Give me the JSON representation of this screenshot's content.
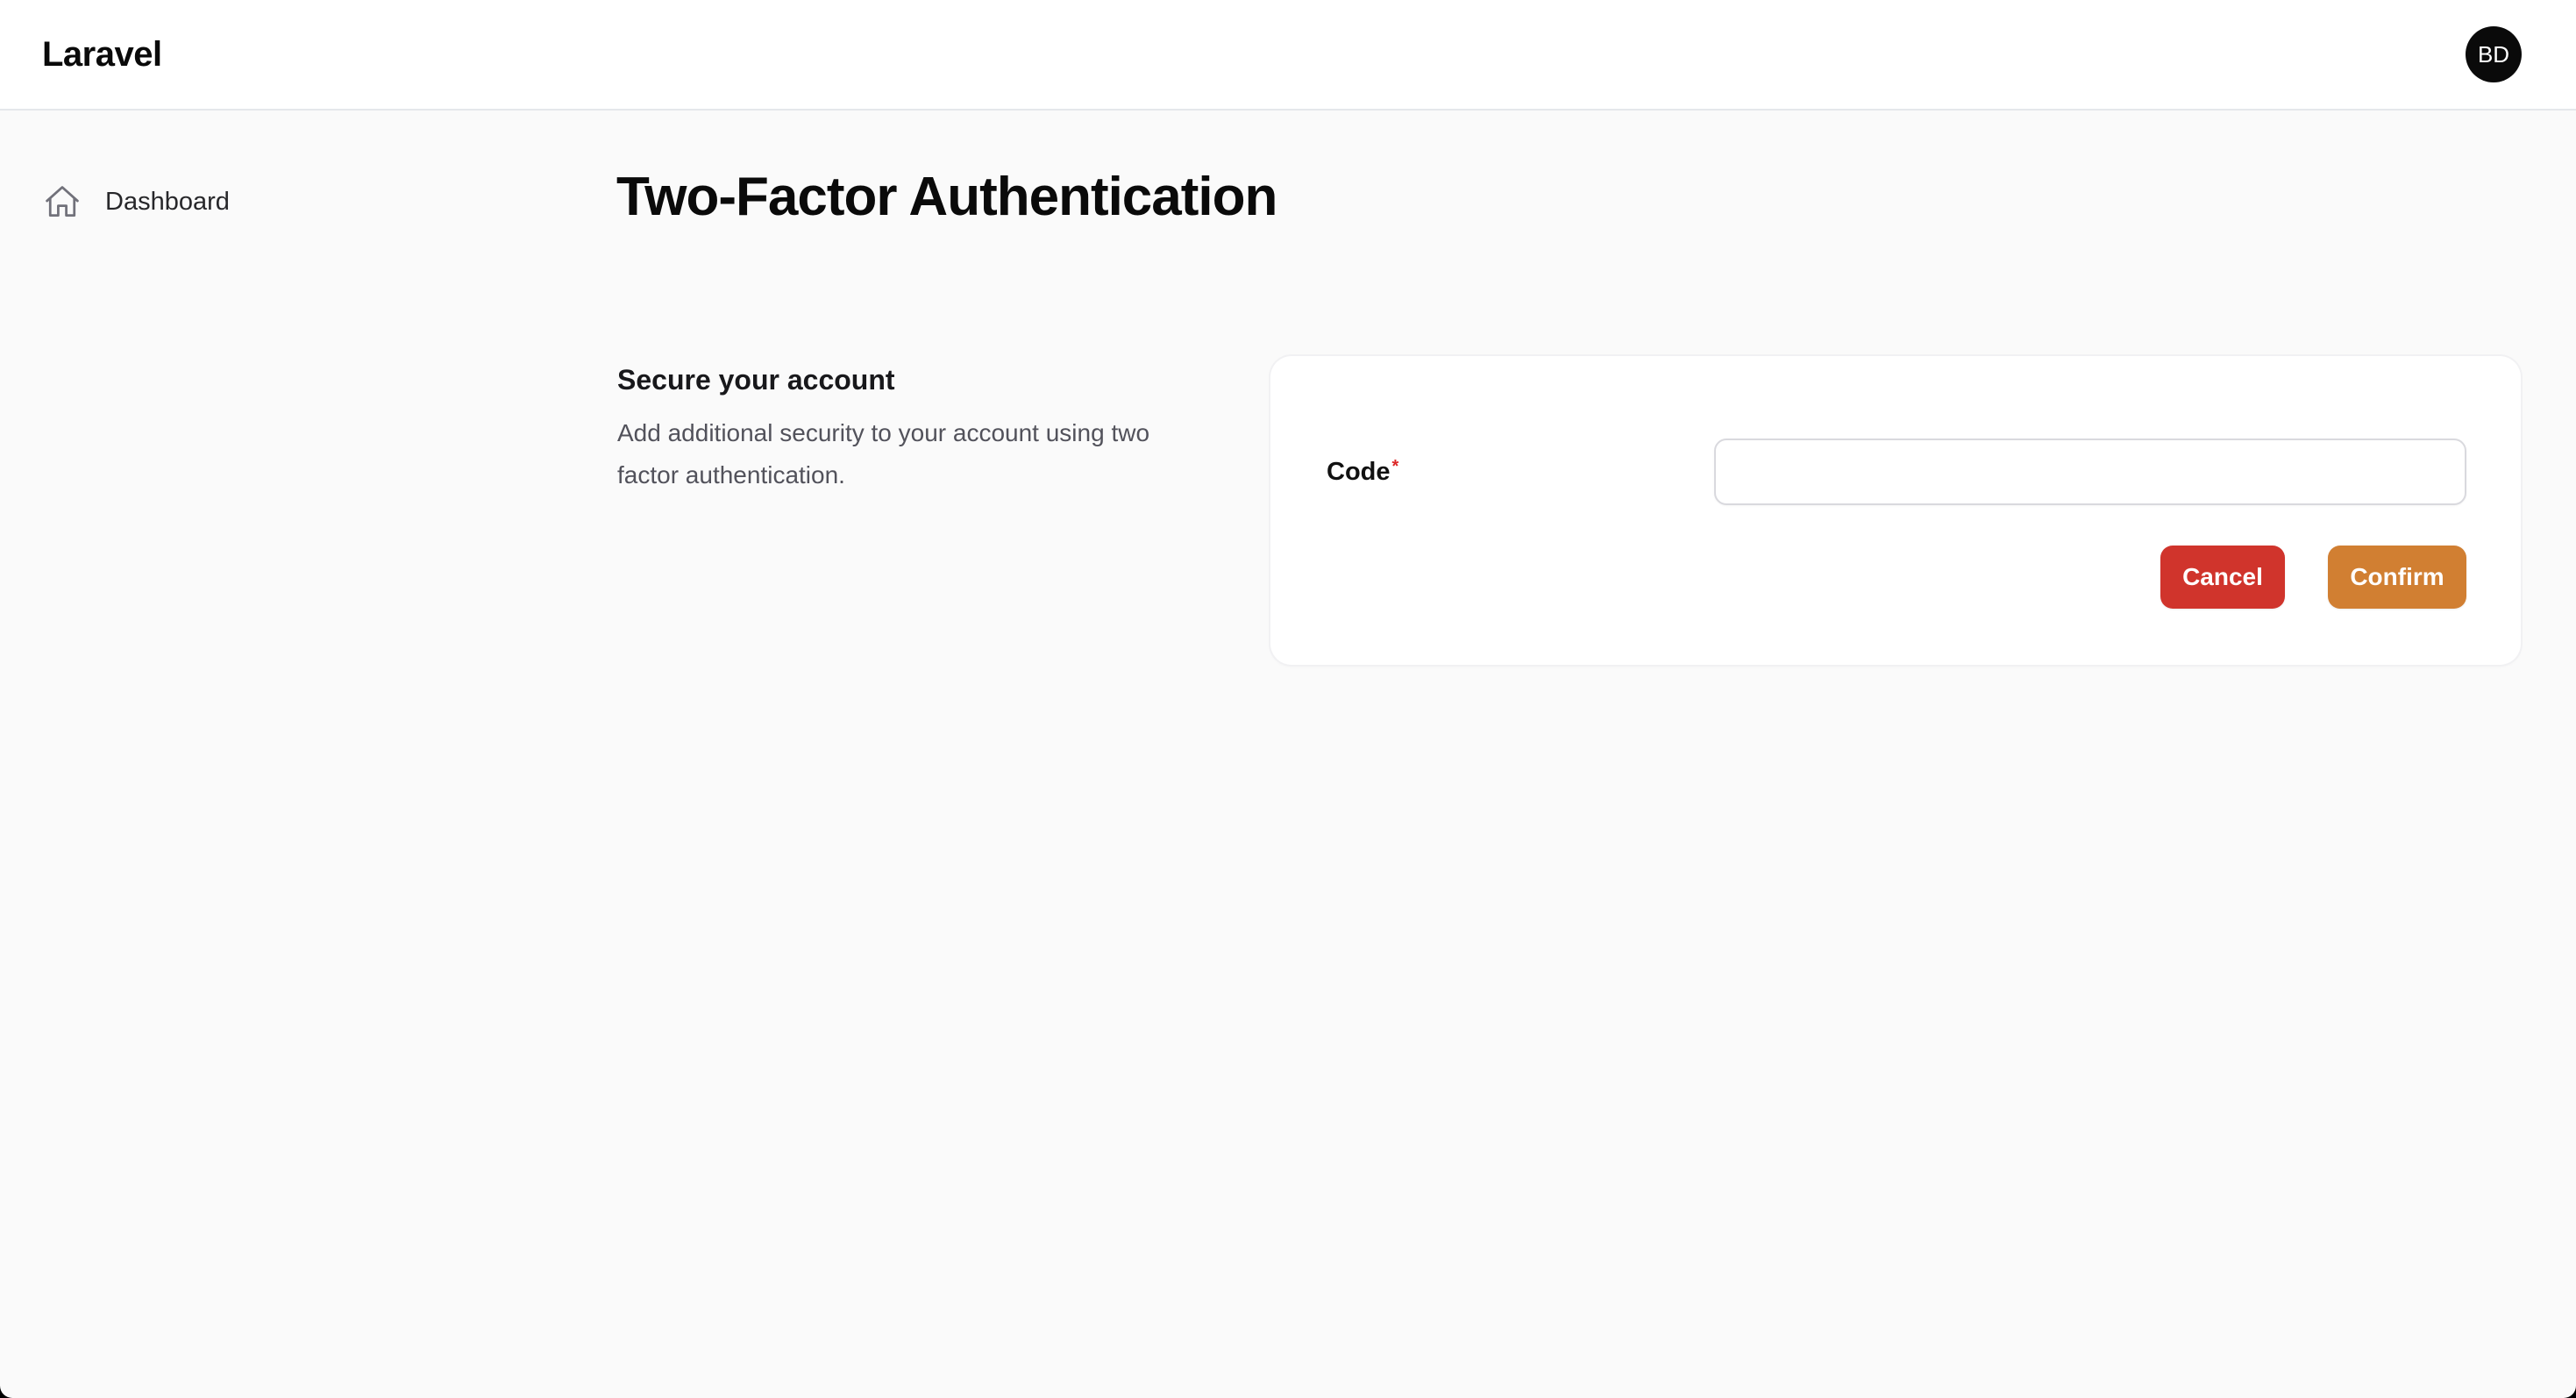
{
  "app": {
    "brand": "Laravel",
    "avatar_initials": "BD"
  },
  "sidebar": {
    "items": [
      {
        "label": "Dashboard",
        "icon": "home-icon"
      }
    ]
  },
  "page": {
    "title": "Two-Factor Authentication"
  },
  "section": {
    "title": "Secure your account",
    "description": "Add additional security to your account using two factor authentication."
  },
  "form": {
    "code_label": "Code",
    "required_marker": "*",
    "code_value": "",
    "cancel_label": "Cancel",
    "confirm_label": "Confirm"
  },
  "colors": {
    "cancel": "#d0342c",
    "confirm": "#d17f32",
    "required": "#dc2626",
    "avatar_bg": "#0a0a0a"
  }
}
